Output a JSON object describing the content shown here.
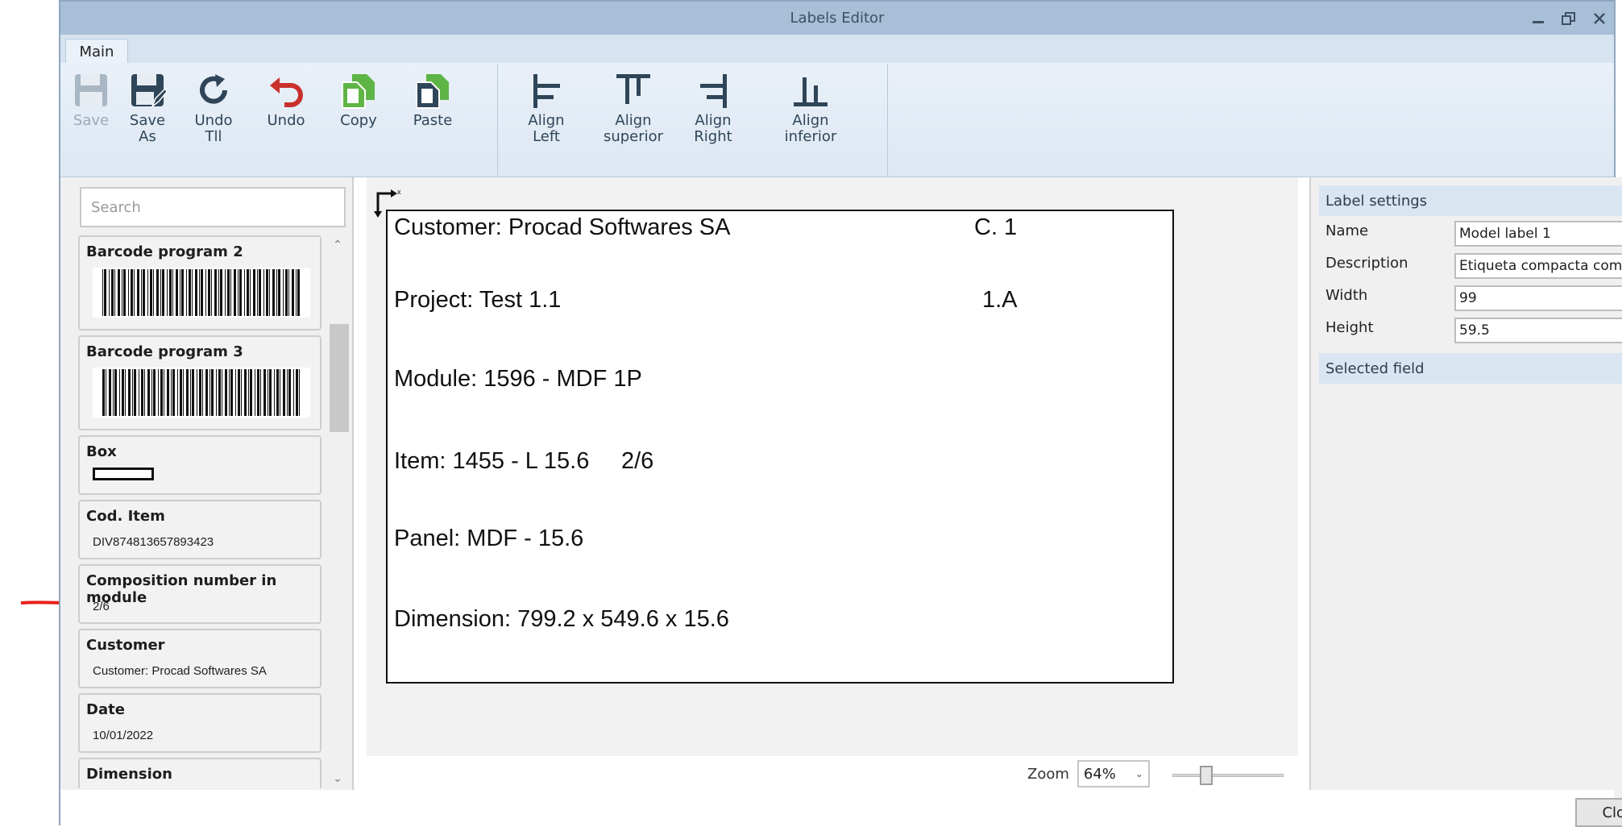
{
  "window": {
    "title": "Labels Editor"
  },
  "tabs": [
    {
      "label": "Main"
    }
  ],
  "ribbon": {
    "save": "Save",
    "save_as": "Save\nAs",
    "undo_all": "Undo\nTll",
    "undo": "Undo",
    "copy": "Copy",
    "paste": "Paste",
    "align_left": "Align\nLeft",
    "align_superior": "Align\nsuperior",
    "align_right": "Align\nRight",
    "align_inferior": "Align\ninferior"
  },
  "left_panel": {
    "search_placeholder": "Search",
    "items": [
      {
        "title": "Barcode program 2",
        "kind": "barcode"
      },
      {
        "title": "Barcode program 3",
        "kind": "barcode"
      },
      {
        "title": "Box",
        "kind": "box"
      },
      {
        "title": "Cod. Item",
        "value": "DIV874813657893423"
      },
      {
        "title": "Composition number in module",
        "value": "2/6"
      },
      {
        "title": "Customer",
        "value": "Customer: Procad Softwares SA"
      },
      {
        "title": "Date",
        "value": "10/01/2022"
      },
      {
        "title": "Dimension"
      }
    ]
  },
  "label_canvas": {
    "axis_x": "x",
    "axis_y": "Y",
    "fields": {
      "customer": "Customer: Procad Softwares SA",
      "c_number": "C. 1",
      "project": "Project: Test 1.1",
      "project_code": "1.A",
      "module": "Module: 1596 - MDF 1P",
      "item": "Item: 1455 - L 15.6",
      "composition": "2/6",
      "panel": "Panel: MDF - 15.6",
      "dimension": "Dimension: 799.2 x 549.6 x 15.6"
    }
  },
  "zoom": {
    "label": "Zoom",
    "value": "64%"
  },
  "right_panel": {
    "label_settings": "Label settings",
    "name_label": "Name",
    "name_value": "Model label 1",
    "description_label": "Description",
    "description_value": "Etiqueta compacta com informa",
    "width_label": "Width",
    "width_value": "99",
    "height_label": "Height",
    "height_value": "59.5",
    "selected_field": "Selected field"
  },
  "footer": {
    "close": "Close"
  },
  "colors": {
    "titlebar": "#a8bfd8",
    "ribbon": "#dde8f3",
    "accent_green": "#5fb446",
    "undo_red": "#c9302c",
    "arrow_red": "#e8201d"
  }
}
